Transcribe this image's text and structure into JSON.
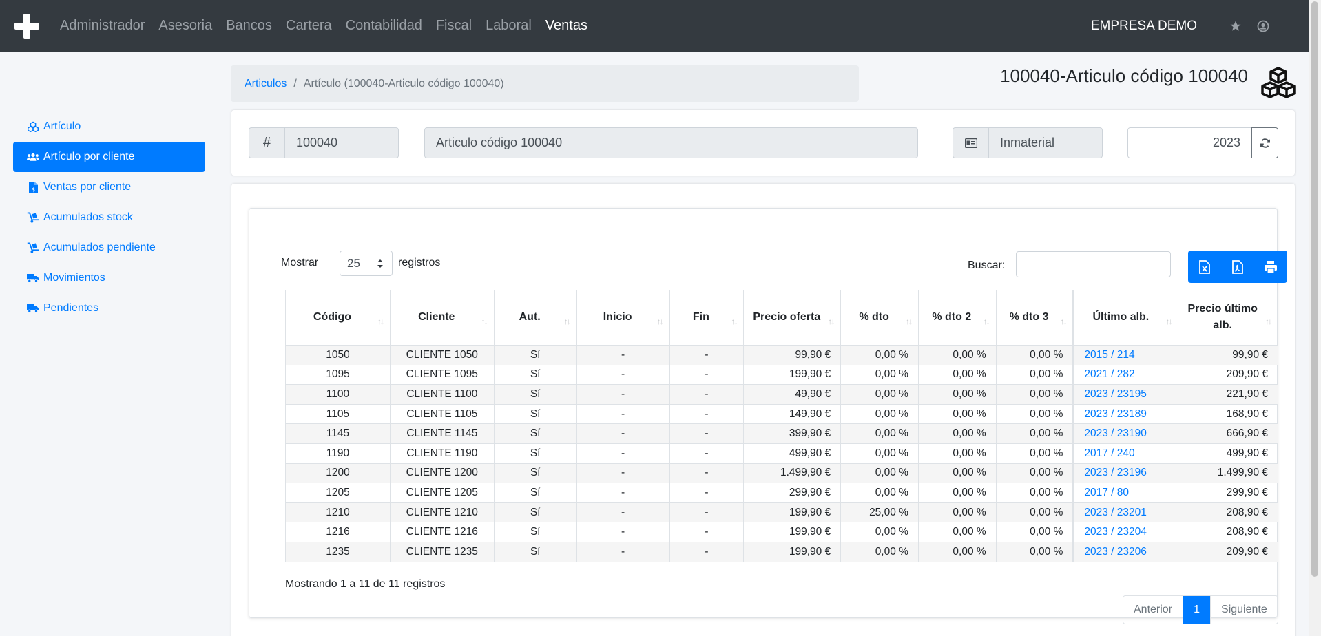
{
  "navbar": {
    "menu": [
      "Administrador",
      "Asesoria",
      "Bancos",
      "Cartera",
      "Contabilidad",
      "Fiscal",
      "Laboral",
      "Ventas"
    ],
    "active": "Ventas",
    "company": "EMPRESA DEMO"
  },
  "sidebar": {
    "items": [
      {
        "label": "Artículo",
        "icon": "cubes-icon"
      },
      {
        "label": "Artículo por cliente",
        "icon": "users-icon",
        "active": true
      },
      {
        "label": "Ventas por cliente",
        "icon": "invoice-icon"
      },
      {
        "label": "Acumulados stock",
        "icon": "dolly-icon"
      },
      {
        "label": "Acumulados pendiente",
        "icon": "dolly-icon"
      },
      {
        "label": "Movimientos",
        "icon": "truck-icon"
      },
      {
        "label": "Pendientes",
        "icon": "truck-icon"
      }
    ]
  },
  "breadcrumb": {
    "link": "Articulos",
    "separator": "/",
    "current": "Artículo (100040-Articulo código 100040)"
  },
  "page_title": "100040-Articulo código 100040",
  "header": {
    "code_addon": "#",
    "code": "100040",
    "description": "Articulo código 100040",
    "type": "Inmaterial",
    "year": "2023"
  },
  "table_controls": {
    "show_label": "Mostrar",
    "length": "25",
    "records_label": "registros",
    "search_label": "Buscar:"
  },
  "table": {
    "columns": [
      "Código",
      "Cliente",
      "Aut.",
      "Inicio",
      "Fin",
      "Precio oferta",
      "% dto",
      "% dto 2",
      "% dto 3",
      "Último alb.",
      "Precio último alb."
    ],
    "rows": [
      [
        "1050",
        "CLIENTE 1050",
        "Sí",
        "-",
        "-",
        "99,90 €",
        "0,00 %",
        "0,00 %",
        "0,00 %",
        "2015 / 214",
        "99,90 €"
      ],
      [
        "1095",
        "CLIENTE 1095",
        "Sí",
        "-",
        "-",
        "199,90 €",
        "0,00 %",
        "0,00 %",
        "0,00 %",
        "2021 / 282",
        "209,90 €"
      ],
      [
        "1100",
        "CLIENTE 1100",
        "Sí",
        "-",
        "-",
        "49,90 €",
        "0,00 %",
        "0,00 %",
        "0,00 %",
        "2023 / 23195",
        "221,90 €"
      ],
      [
        "1105",
        "CLIENTE 1105",
        "Sí",
        "-",
        "-",
        "149,90 €",
        "0,00 %",
        "0,00 %",
        "0,00 %",
        "2023 / 23189",
        "168,90 €"
      ],
      [
        "1145",
        "CLIENTE 1145",
        "Sí",
        "-",
        "-",
        "399,90 €",
        "0,00 %",
        "0,00 %",
        "0,00 %",
        "2023 / 23190",
        "666,90 €"
      ],
      [
        "1190",
        "CLIENTE 1190",
        "Sí",
        "-",
        "-",
        "499,90 €",
        "0,00 %",
        "0,00 %",
        "0,00 %",
        "2017 / 240",
        "499,90 €"
      ],
      [
        "1200",
        "CLIENTE 1200",
        "Sí",
        "-",
        "-",
        "1.499,90 €",
        "0,00 %",
        "0,00 %",
        "0,00 %",
        "2023 / 23196",
        "1.499,90 €"
      ],
      [
        "1205",
        "CLIENTE 1205",
        "Sí",
        "-",
        "-",
        "299,90 €",
        "0,00 %",
        "0,00 %",
        "0,00 %",
        "2017 / 80",
        "299,90 €"
      ],
      [
        "1210",
        "CLIENTE 1210",
        "Sí",
        "-",
        "-",
        "199,90 €",
        "25,00 %",
        "0,00 %",
        "0,00 %",
        "2023 / 23201",
        "208,90 €"
      ],
      [
        "1216",
        "CLIENTE 1216",
        "Sí",
        "-",
        "-",
        "199,90 €",
        "0,00 %",
        "0,00 %",
        "0,00 %",
        "2023 / 23204",
        "208,90 €"
      ],
      [
        "1235",
        "CLIENTE 1235",
        "Sí",
        "-",
        "-",
        "199,90 €",
        "0,00 %",
        "0,00 %",
        "0,00 %",
        "2023 / 23206",
        "209,90 €"
      ]
    ]
  },
  "footer": {
    "info": "Mostrando 1 a 11 de 11 registros",
    "prev": "Anterior",
    "page": "1",
    "next": "Siguiente"
  },
  "colors": {
    "navbar": "#343a40",
    "accent": "#007bff"
  }
}
